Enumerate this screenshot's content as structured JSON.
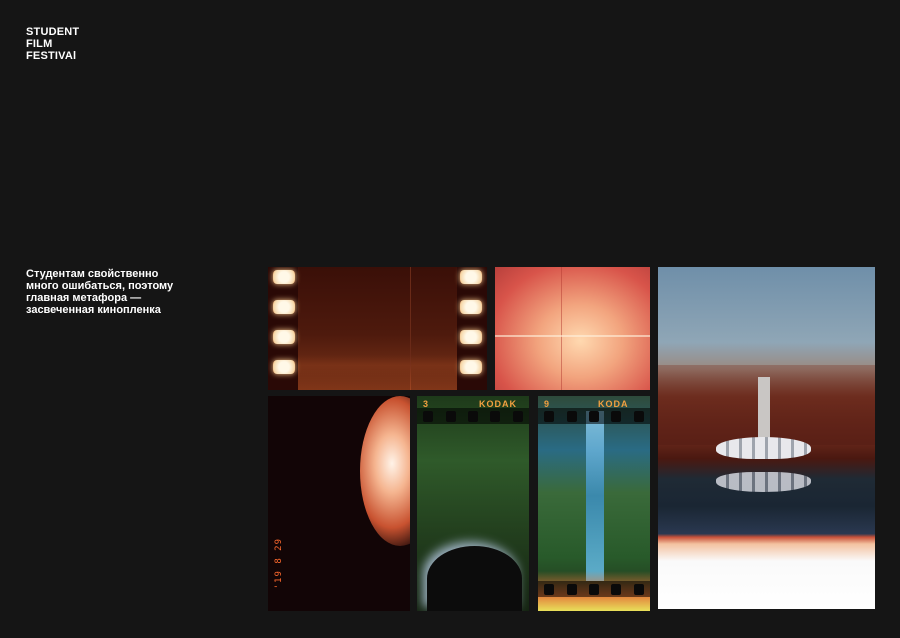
{
  "header": {
    "title_lines": [
      "STUDENT",
      "FILM",
      "FESTIVAl"
    ]
  },
  "description": {
    "text": "Студентам свойственно много ошибаться, поэтому главная метафора — засвеченная кинопленка"
  },
  "photos": {
    "date_stamp": "'19 8 29",
    "kodak_strip_1": {
      "frame_number": "3",
      "brand": "KODAK"
    },
    "kodak_strip_2": {
      "frame_number": "9",
      "brand": "KODA"
    }
  }
}
